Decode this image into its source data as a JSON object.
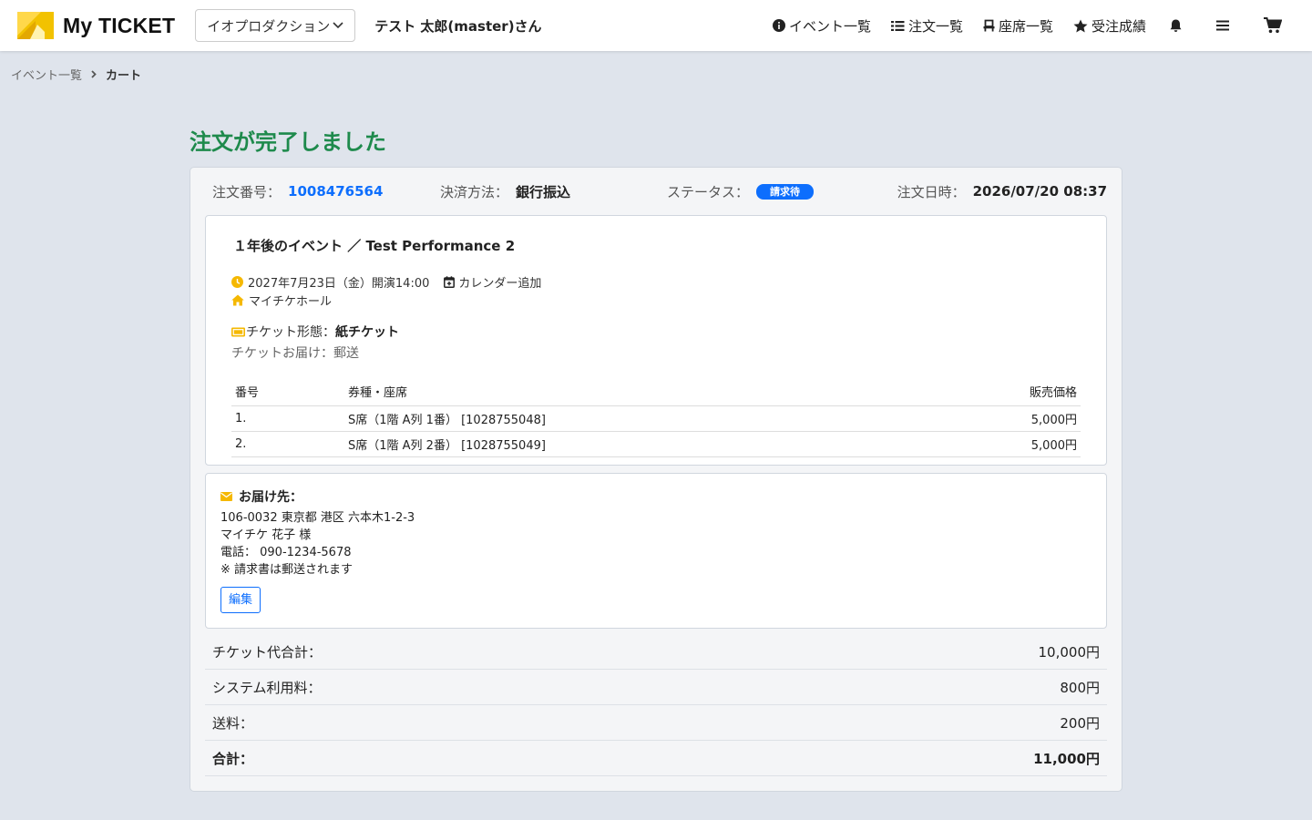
{
  "header": {
    "logo_text": "My TICKET",
    "org_select": "イオプロダクション",
    "user_name": "テスト 太郎(master)さん",
    "nav": [
      {
        "label": "イベント一覧",
        "icon": "info-circle-icon"
      },
      {
        "label": "注文一覧",
        "icon": "list-icon"
      },
      {
        "label": "座席一覧",
        "icon": "seat-icon"
      },
      {
        "label": "受注成績",
        "icon": "star-icon"
      }
    ],
    "icons": [
      "bell-icon",
      "menu-icon",
      "cart-icon"
    ]
  },
  "breadcrumb": {
    "items": [
      "イベント一覧",
      "カート"
    ]
  },
  "page_title": "注文が完了しました",
  "order": {
    "number_label": "注文番号：",
    "number": "1008476564",
    "payment_label": "決済方法：",
    "payment": "銀行振込",
    "status_label": "ステータス：",
    "status": "請求待",
    "date_label": "注文日時：",
    "date": "2026/07/20 08:37"
  },
  "event": {
    "title": "１年後のイベント ／ Test Performance 2",
    "datetime": "2027年7月23日（金）開演14:00",
    "calendar_label": "カレンダー追加",
    "venue": "マイチケホール",
    "ticket_type_label": "チケット形態：",
    "ticket_type": "紙チケット",
    "delivery": "チケットお届け：郵送"
  },
  "items_table": {
    "headers": [
      "番号",
      "券種・座席",
      "販売価格"
    ],
    "rows": [
      {
        "no": "1.",
        "seat": "S席（1階 A列 1番） [1028755048]",
        "price": "5,000円"
      },
      {
        "no": "2.",
        "seat": "S席（1階 A列 2番） [1028755049]",
        "price": "5,000円"
      }
    ]
  },
  "address": {
    "heading": "お届け先：",
    "postal_address": "106-0032 東京都 港区 六本木1-2-3",
    "name": "マイチケ 花子 様",
    "phone": "電話： 090-1234-5678",
    "note": "※ 請求書は郵送されます",
    "edit_label": "編集"
  },
  "totals": [
    {
      "label": "チケット代合計：",
      "value": "10,000円"
    },
    {
      "label": "システム利用料：",
      "value": "800円"
    },
    {
      "label": "送料：",
      "value": "200円"
    },
    {
      "label": "合計：",
      "value": "11,000円"
    }
  ],
  "colors": {
    "title_green": "#1e8a4c",
    "link_blue": "#0d6efd",
    "icon_yellow": "#f5b800",
    "background": "#dfe4ec"
  }
}
